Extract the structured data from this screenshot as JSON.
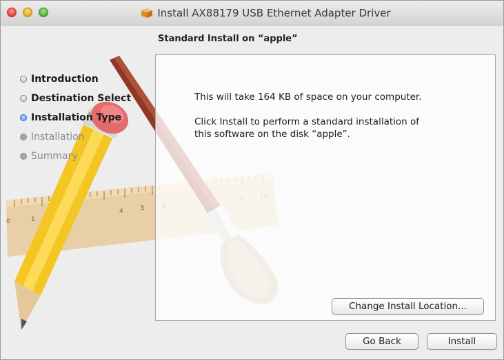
{
  "window": {
    "title": "Install AX88179 USB Ethernet Adapter Driver",
    "title_icon": "package-box-icon"
  },
  "heading": "Standard Install on “apple”",
  "steps": [
    {
      "label": "Introduction",
      "state": "done"
    },
    {
      "label": "Destination Select",
      "state": "done"
    },
    {
      "label": "Installation Type",
      "state": "current"
    },
    {
      "label": "Installation",
      "state": "pending"
    },
    {
      "label": "Summary",
      "state": "pending"
    }
  ],
  "content": {
    "space_text": "This will take 164 KB of space on your computer.",
    "install_text_line1": "Click Install to perform a standard installation of",
    "install_text_line2": "this software on the disk “apple”."
  },
  "buttons": {
    "change_location": "Change Install Location...",
    "go_back": "Go Back",
    "install": "Install"
  },
  "ruler_numbers": [
    "0",
    "1",
    "4",
    "5",
    "6",
    "9",
    "10"
  ],
  "background_art": "pencil-ruler-brush-illustration"
}
